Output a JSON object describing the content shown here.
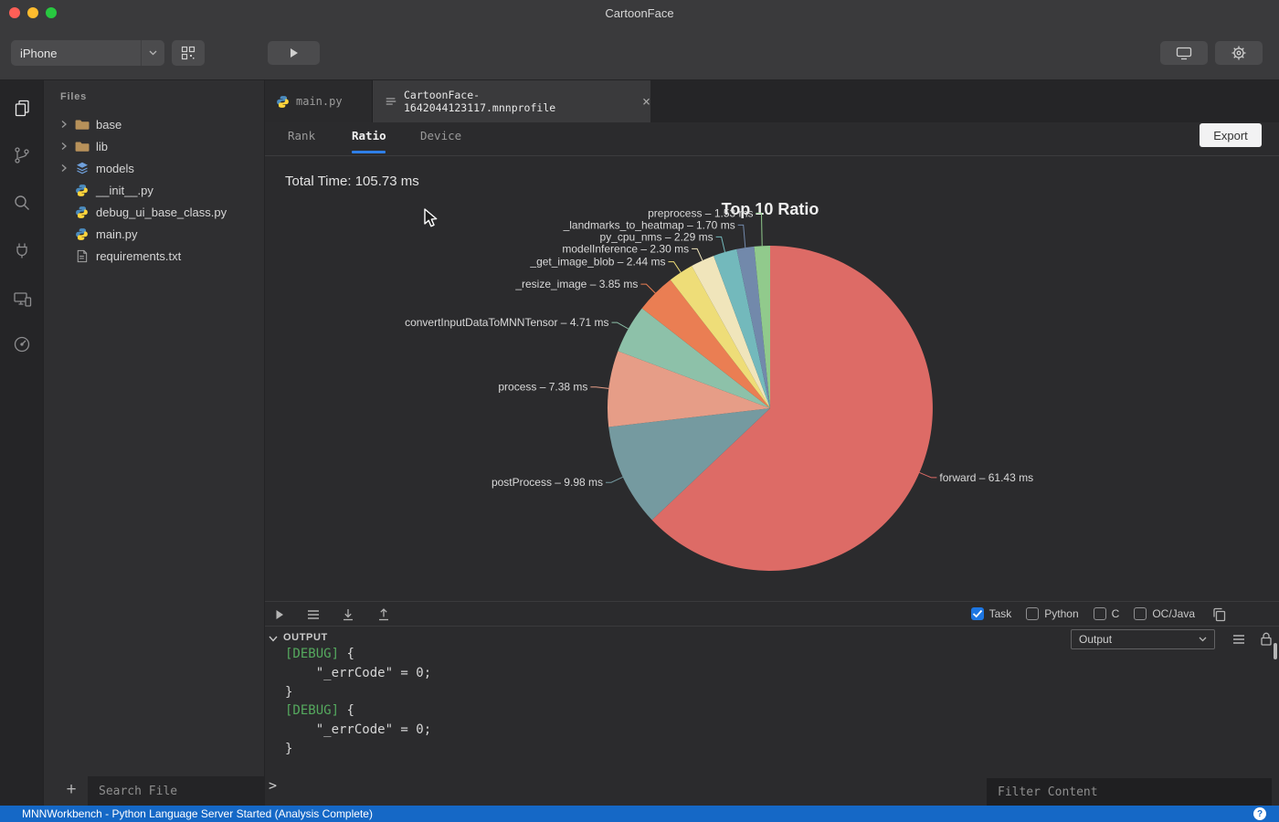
{
  "window": {
    "title": "CartoonFace"
  },
  "toolbar": {
    "device_value": "iPhone"
  },
  "sidebar": {
    "header": "Files",
    "items": [
      {
        "label": "base",
        "type": "folder"
      },
      {
        "label": "lib",
        "type": "folder"
      },
      {
        "label": "models",
        "type": "models-folder"
      },
      {
        "label": "__init__.py",
        "type": "python"
      },
      {
        "label": "debug_ui_base_class.py",
        "type": "python"
      },
      {
        "label": "main.py",
        "type": "python"
      },
      {
        "label": "requirements.txt",
        "type": "text"
      }
    ],
    "add_button": "+",
    "search_placeholder": "Search File"
  },
  "editor": {
    "tabs": [
      {
        "label": "main.py",
        "active": false
      },
      {
        "label": "CartoonFace-1642044123117.mnnprofile",
        "active": true,
        "close": "×"
      }
    ]
  },
  "profile": {
    "tabs": [
      {
        "label": "Rank",
        "active": false
      },
      {
        "label": "Ratio",
        "active": true
      },
      {
        "label": "Device",
        "active": false
      }
    ],
    "export_button": "Export",
    "total_time": "Total Time: 105.73 ms"
  },
  "chart_data": {
    "type": "pie",
    "title": "Top 10 Ratio",
    "unit": "ms",
    "total_time_ms": 105.73,
    "legend": false,
    "label_format": "{name} – {display}",
    "slices": [
      {
        "name": "forward",
        "value": 61.43,
        "display": "61.43 ms",
        "color": "#dd6b66"
      },
      {
        "name": "postProcess",
        "value": 9.98,
        "display": "9.98 ms",
        "color": "#759aa0"
      },
      {
        "name": "process",
        "value": 7.38,
        "display": "7.38 ms",
        "color": "#e69d87"
      },
      {
        "name": "convertInputDataToMNNTensor",
        "value": 4.71,
        "display": "4.71 ms",
        "color": "#8dc1a9"
      },
      {
        "name": "_resize_image",
        "value": 3.85,
        "display": "3.85 ms",
        "color": "#ea7e53"
      },
      {
        "name": "_get_image_blob",
        "value": 2.44,
        "display": "2.44 ms",
        "color": "#eedd78"
      },
      {
        "name": "modelInference",
        "value": 2.3,
        "display": "2.30 ms",
        "color": "#f0e5bb"
      },
      {
        "name": "py_cpu_nms",
        "value": 2.29,
        "display": "2.29 ms",
        "color": "#73b9bc"
      },
      {
        "name": "_landmarks_to_heatmap",
        "value": 1.7,
        "display": "1.70 ms",
        "color": "#7289ab"
      },
      {
        "name": "preprocess",
        "value": 1.53,
        "display": "1.53 ms",
        "color": "#91ca8c"
      }
    ]
  },
  "runner": {
    "checkboxes": [
      {
        "label": "Task",
        "checked": true
      },
      {
        "label": "Python",
        "checked": false
      },
      {
        "label": "C",
        "checked": false
      },
      {
        "label": "OC/Java",
        "checked": false
      }
    ]
  },
  "output": {
    "header": "OUTPUT",
    "channel_value": "Output",
    "lines": [
      {
        "tag": "[DEBUG]",
        "rest": " {"
      },
      {
        "text": "    \"_errCode\" = 0;"
      },
      {
        "text": "}"
      },
      {
        "tag": "[DEBUG]",
        "rest": " {"
      },
      {
        "text": "    \"_errCode\" = 0;"
      },
      {
        "text": "}"
      }
    ],
    "prompt": ">",
    "filter_placeholder": "Filter Content"
  },
  "status_bar": {
    "message": "MNNWorkbench - Python Language Server Started (Analysis Complete)",
    "help": "?"
  }
}
